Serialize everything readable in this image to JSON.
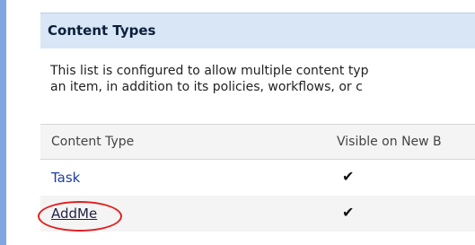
{
  "section": {
    "title": "Content Types"
  },
  "description": {
    "line1": "This list is configured to allow multiple content typ",
    "line2": "an item, in addition to its policies, workflows, or c"
  },
  "table": {
    "columns": [
      "Content Type",
      "Visible on New B"
    ],
    "rows": [
      {
        "name": "Task",
        "visible_mark": "✔"
      },
      {
        "name": "AddMe",
        "visible_mark": "✔"
      }
    ]
  },
  "colors": {
    "left_bar": "#7ea6e0",
    "header_bg": "#d9e6f6",
    "link": "#1d3fa0",
    "highlight_ring": "#e02020"
  },
  "icons": {
    "check": "checkmark-icon"
  }
}
